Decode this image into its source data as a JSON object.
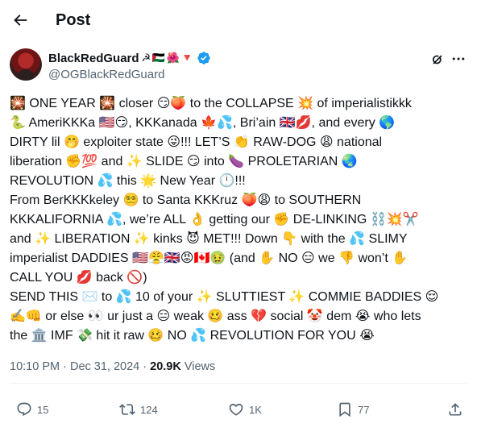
{
  "header": {
    "title": "Post"
  },
  "author": {
    "display_name": "BlackRedGuard",
    "name_emojis": "☭ 🇵🇸 🌺 🔻",
    "handle": "@OGBlackRedGuard"
  },
  "tweet": {
    "text": "🎇 ONE YEAR 🎇 closer 😏🍑 to the COLLAPSE 💥 of imperialistikkk\n🐍 AmeriKKKa 🇺🇸😏, KKKanada 🍁💦, Bri’ain 🇬🇧💋, and every 🌎\nDIRTY lil 🤭 exploiter state 😜!!! LET’S 👏 RAW-DOG 😩 national\nliberation ✊💯 and ✨ SLIDE 😏 into 🍆 PROLETARIAN 🌏\nREVOLUTION 💦 this 🌟 New Year 🕛!!!\nFrom BerKKKkeley 😵‍💫 to Santa KKKruz 🍑😩 to SOUTHERN\nKKKALIFORNIA 💦, we’re ALL 👌 getting our ✊ DE-LINKING ⛓️💥✂️\nand ✨ LIBERATION ✨ kinks 😈 MET!!! Down 👇 with the 💦 SLIMY\nimperialist DADDIES 🇺🇸😤🇬🇧😡🇨🇦🤢 (and ✋ NO 😑 we 👎 won’t ✋\nCALL YOU 💋 back 🚫)\nSEND THIS ✉️ to 💦 10 of your ✨ SLUTTIEST ✨ COMMIE BADDIES 😌\n✍️👊 or else 👀 ur just a 😑 weak 🥴 ass 💔 social 🤡 dem 😭 who lets\nthe 🏛️ IMF 💸 hit it raw 🥴 NO 💦 REVOLUTION FOR YOU 😭"
  },
  "meta": {
    "time": "10:10 PM",
    "separator": " · ",
    "date": "Dec 31, 2024",
    "dot": " · ",
    "views_count": "20.9K",
    "views_label": " Views"
  },
  "actions": {
    "reply_count": "15",
    "retweet_count": "124",
    "like_count": "1K",
    "bookmark_count": "77"
  },
  "colors": {
    "text": "#0f1419",
    "secondary": "#536471",
    "verified": "#1d9bf0",
    "divider": "#eff3f4"
  },
  "icons": [
    "back-arrow-icon",
    "verified-badge-icon",
    "grok-icon",
    "more-icon",
    "reply-icon",
    "retweet-icon",
    "like-icon",
    "bookmark-icon",
    "share-icon"
  ]
}
